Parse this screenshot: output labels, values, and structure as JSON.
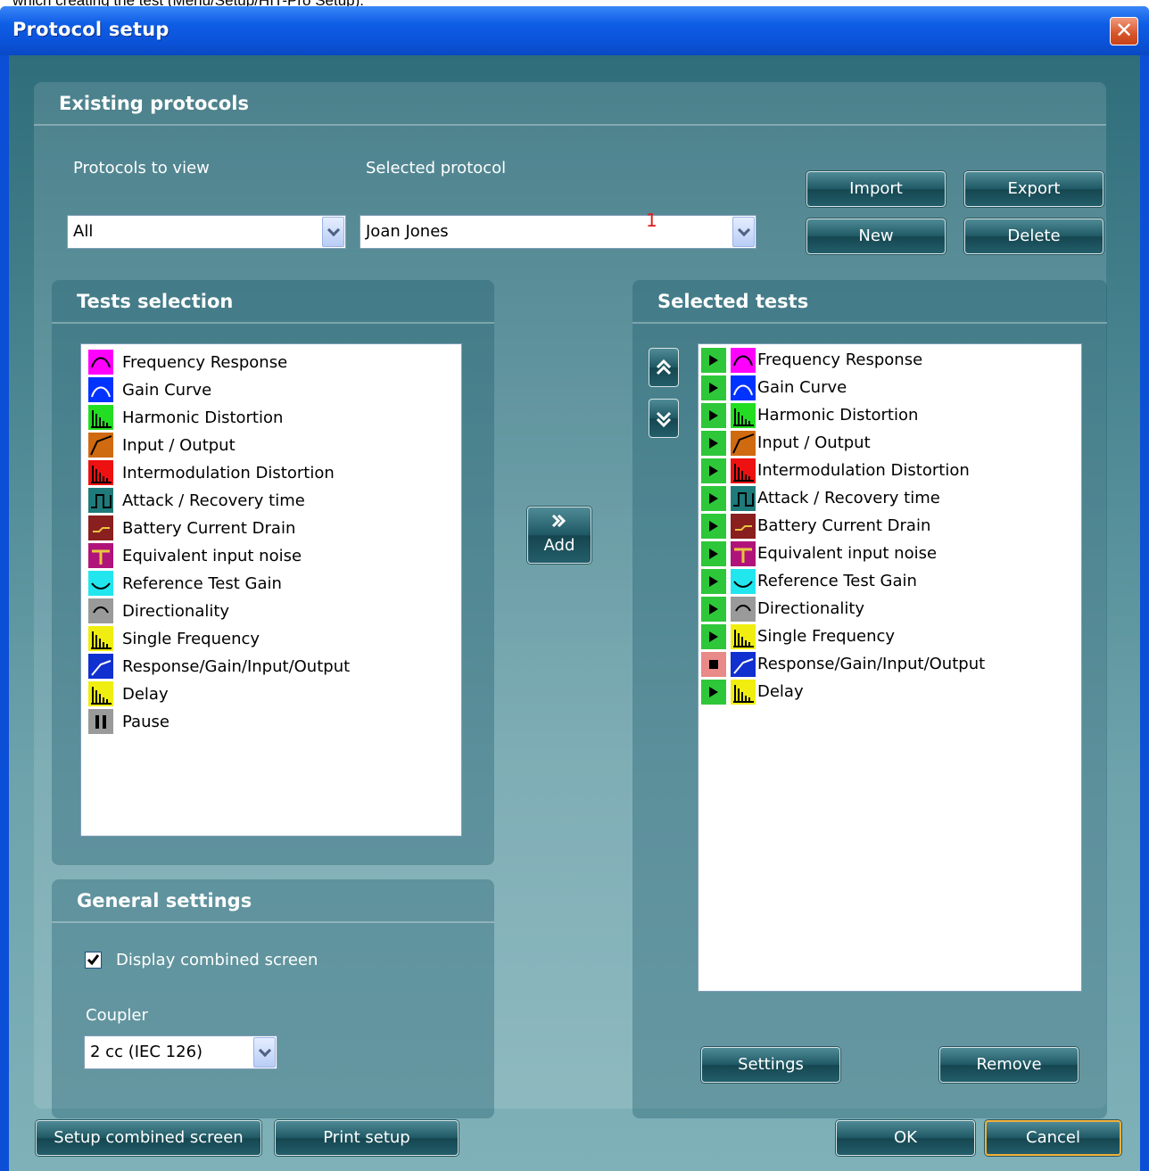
{
  "caption_fragment": "which creating the test (Menu/Setup/HIT-Pro Setup).",
  "window": {
    "title": "Protocol setup",
    "close_label": "✕"
  },
  "existing": {
    "title": "Existing protocols",
    "protocols_to_view_label": "Protocols to view",
    "protocols_to_view_value": "All",
    "selected_protocol_label": "Selected protocol",
    "selected_protocol_value": "Joan Jones",
    "annotation": "1",
    "buttons": {
      "import": "Import",
      "export": "Export",
      "new": "New",
      "delete": "Delete"
    }
  },
  "tests_selection": {
    "title": "Tests selection",
    "items": [
      {
        "label": "Frequency Response",
        "icon": "frequency-response-icon",
        "color": "#ff00ff"
      },
      {
        "label": "Gain Curve",
        "icon": "gain-curve-icon",
        "color": "#0033ff"
      },
      {
        "label": "Harmonic Distortion",
        "icon": "harmonic-distortion-icon",
        "color": "#22dd22"
      },
      {
        "label": "Input / Output",
        "icon": "input-output-icon",
        "color": "#d06a10"
      },
      {
        "label": "Intermodulation Distortion",
        "icon": "intermodulation-distortion-icon",
        "color": "#ee1111"
      },
      {
        "label": "Attack / Recovery time",
        "icon": "attack-recovery-icon",
        "color": "#1f7b7b"
      },
      {
        "label": "Battery Current Drain",
        "icon": "battery-current-drain-icon",
        "color": "#8a1f1f"
      },
      {
        "label": "Equivalent input noise",
        "icon": "equivalent-input-noise-icon",
        "color": "#b0147a"
      },
      {
        "label": "Reference Test Gain",
        "icon": "reference-test-gain-icon",
        "color": "#22e6ee"
      },
      {
        "label": "Directionality",
        "icon": "directionality-icon",
        "color": "#9a9a9a"
      },
      {
        "label": "Single Frequency",
        "icon": "single-frequency-icon",
        "color": "#f0ee10"
      },
      {
        "label": "Response/Gain/Input/Output",
        "icon": "response-gain-input-output-icon",
        "color": "#1030d0"
      },
      {
        "label": "Delay",
        "icon": "delay-icon",
        "color": "#f0ee10"
      },
      {
        "label": "Pause",
        "icon": "pause-icon",
        "color": "#9a9a9a"
      }
    ]
  },
  "add_button_label": "Add",
  "selected_tests": {
    "title": "Selected tests",
    "items": [
      {
        "label": "Frequency Response",
        "state": "play"
      },
      {
        "label": "Gain Curve",
        "state": "play"
      },
      {
        "label": "Harmonic Distortion",
        "state": "play"
      },
      {
        "label": "Input / Output",
        "state": "play"
      },
      {
        "label": "Intermodulation Distortion",
        "state": "play"
      },
      {
        "label": "Attack / Recovery time",
        "state": "play"
      },
      {
        "label": "Battery Current Drain",
        "state": "play"
      },
      {
        "label": "Equivalent input noise",
        "state": "play"
      },
      {
        "label": "Reference Test Gain",
        "state": "play"
      },
      {
        "label": "Directionality",
        "state": "play"
      },
      {
        "label": "Single Frequency",
        "state": "play"
      },
      {
        "label": "Response/Gain/Input/Output",
        "state": "stop"
      },
      {
        "label": "Delay",
        "state": "play"
      }
    ],
    "settings_label": "Settings",
    "remove_label": "Remove"
  },
  "general": {
    "title": "General settings",
    "display_combined_label": "Display combined screen",
    "display_combined_checked": true,
    "coupler_label": "Coupler",
    "coupler_value": "2 cc (IEC 126)"
  },
  "footer": {
    "setup_combined_label": "Setup combined screen",
    "print_setup_label": "Print setup",
    "ok_label": "OK",
    "cancel_label": "Cancel"
  }
}
